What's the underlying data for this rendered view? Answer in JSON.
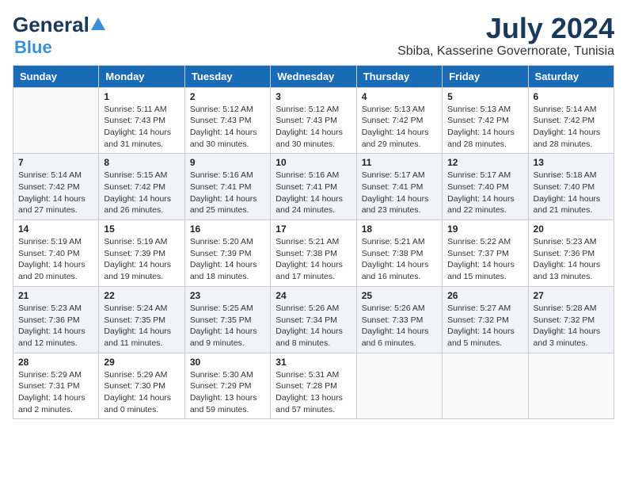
{
  "header": {
    "logo_general": "General",
    "logo_blue": "Blue",
    "month_year": "July 2024",
    "location": "Sbiba, Kasserine Governorate, Tunisia"
  },
  "calendar": {
    "days_of_week": [
      "Sunday",
      "Monday",
      "Tuesday",
      "Wednesday",
      "Thursday",
      "Friday",
      "Saturday"
    ],
    "weeks": [
      [
        {
          "day": "",
          "detail": ""
        },
        {
          "day": "1",
          "detail": "Sunrise: 5:11 AM\nSunset: 7:43 PM\nDaylight: 14 hours\nand 31 minutes."
        },
        {
          "day": "2",
          "detail": "Sunrise: 5:12 AM\nSunset: 7:43 PM\nDaylight: 14 hours\nand 30 minutes."
        },
        {
          "day": "3",
          "detail": "Sunrise: 5:12 AM\nSunset: 7:43 PM\nDaylight: 14 hours\nand 30 minutes."
        },
        {
          "day": "4",
          "detail": "Sunrise: 5:13 AM\nSunset: 7:42 PM\nDaylight: 14 hours\nand 29 minutes."
        },
        {
          "day": "5",
          "detail": "Sunrise: 5:13 AM\nSunset: 7:42 PM\nDaylight: 14 hours\nand 28 minutes."
        },
        {
          "day": "6",
          "detail": "Sunrise: 5:14 AM\nSunset: 7:42 PM\nDaylight: 14 hours\nand 28 minutes."
        }
      ],
      [
        {
          "day": "7",
          "detail": "Sunrise: 5:14 AM\nSunset: 7:42 PM\nDaylight: 14 hours\nand 27 minutes."
        },
        {
          "day": "8",
          "detail": "Sunrise: 5:15 AM\nSunset: 7:42 PM\nDaylight: 14 hours\nand 26 minutes."
        },
        {
          "day": "9",
          "detail": "Sunrise: 5:16 AM\nSunset: 7:41 PM\nDaylight: 14 hours\nand 25 minutes."
        },
        {
          "day": "10",
          "detail": "Sunrise: 5:16 AM\nSunset: 7:41 PM\nDaylight: 14 hours\nand 24 minutes."
        },
        {
          "day": "11",
          "detail": "Sunrise: 5:17 AM\nSunset: 7:41 PM\nDaylight: 14 hours\nand 23 minutes."
        },
        {
          "day": "12",
          "detail": "Sunrise: 5:17 AM\nSunset: 7:40 PM\nDaylight: 14 hours\nand 22 minutes."
        },
        {
          "day": "13",
          "detail": "Sunrise: 5:18 AM\nSunset: 7:40 PM\nDaylight: 14 hours\nand 21 minutes."
        }
      ],
      [
        {
          "day": "14",
          "detail": "Sunrise: 5:19 AM\nSunset: 7:40 PM\nDaylight: 14 hours\nand 20 minutes."
        },
        {
          "day": "15",
          "detail": "Sunrise: 5:19 AM\nSunset: 7:39 PM\nDaylight: 14 hours\nand 19 minutes."
        },
        {
          "day": "16",
          "detail": "Sunrise: 5:20 AM\nSunset: 7:39 PM\nDaylight: 14 hours\nand 18 minutes."
        },
        {
          "day": "17",
          "detail": "Sunrise: 5:21 AM\nSunset: 7:38 PM\nDaylight: 14 hours\nand 17 minutes."
        },
        {
          "day": "18",
          "detail": "Sunrise: 5:21 AM\nSunset: 7:38 PM\nDaylight: 14 hours\nand 16 minutes."
        },
        {
          "day": "19",
          "detail": "Sunrise: 5:22 AM\nSunset: 7:37 PM\nDaylight: 14 hours\nand 15 minutes."
        },
        {
          "day": "20",
          "detail": "Sunrise: 5:23 AM\nSunset: 7:36 PM\nDaylight: 14 hours\nand 13 minutes."
        }
      ],
      [
        {
          "day": "21",
          "detail": "Sunrise: 5:23 AM\nSunset: 7:36 PM\nDaylight: 14 hours\nand 12 minutes."
        },
        {
          "day": "22",
          "detail": "Sunrise: 5:24 AM\nSunset: 7:35 PM\nDaylight: 14 hours\nand 11 minutes."
        },
        {
          "day": "23",
          "detail": "Sunrise: 5:25 AM\nSunset: 7:35 PM\nDaylight: 14 hours\nand 9 minutes."
        },
        {
          "day": "24",
          "detail": "Sunrise: 5:26 AM\nSunset: 7:34 PM\nDaylight: 14 hours\nand 8 minutes."
        },
        {
          "day": "25",
          "detail": "Sunrise: 5:26 AM\nSunset: 7:33 PM\nDaylight: 14 hours\nand 6 minutes."
        },
        {
          "day": "26",
          "detail": "Sunrise: 5:27 AM\nSunset: 7:32 PM\nDaylight: 14 hours\nand 5 minutes."
        },
        {
          "day": "27",
          "detail": "Sunrise: 5:28 AM\nSunset: 7:32 PM\nDaylight: 14 hours\nand 3 minutes."
        }
      ],
      [
        {
          "day": "28",
          "detail": "Sunrise: 5:29 AM\nSunset: 7:31 PM\nDaylight: 14 hours\nand 2 minutes."
        },
        {
          "day": "29",
          "detail": "Sunrise: 5:29 AM\nSunset: 7:30 PM\nDaylight: 14 hours\nand 0 minutes."
        },
        {
          "day": "30",
          "detail": "Sunrise: 5:30 AM\nSunset: 7:29 PM\nDaylight: 13 hours\nand 59 minutes."
        },
        {
          "day": "31",
          "detail": "Sunrise: 5:31 AM\nSunset: 7:28 PM\nDaylight: 13 hours\nand 57 minutes."
        },
        {
          "day": "",
          "detail": ""
        },
        {
          "day": "",
          "detail": ""
        },
        {
          "day": "",
          "detail": ""
        }
      ]
    ]
  }
}
